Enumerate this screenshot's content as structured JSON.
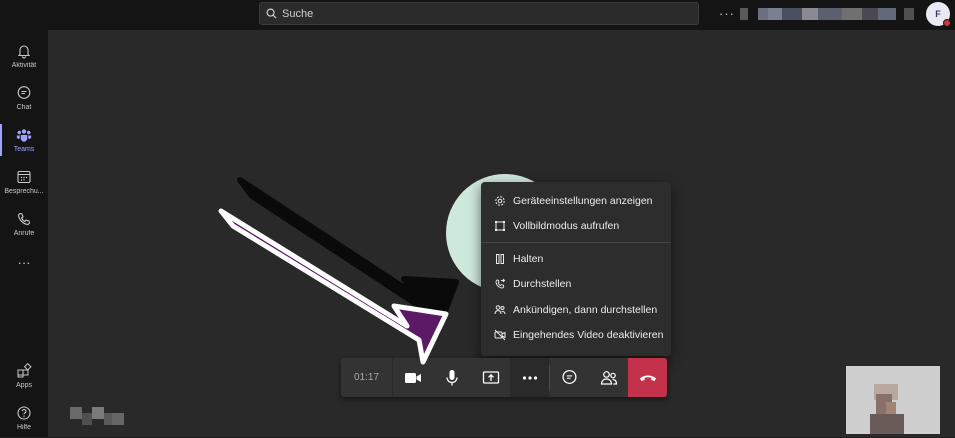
{
  "search": {
    "placeholder": "Suche"
  },
  "topbar": {
    "more": "···",
    "avatar_initial": "F"
  },
  "rail": {
    "items": [
      {
        "label": "Aktivität",
        "icon": "bell-icon"
      },
      {
        "label": "Chat",
        "icon": "chat-icon"
      },
      {
        "label": "Teams",
        "icon": "teams-icon",
        "active": true
      },
      {
        "label": "Besprechu...",
        "icon": "calendar-icon"
      },
      {
        "label": "Anrufe",
        "icon": "phone-icon"
      }
    ],
    "more": "···",
    "apps": "Apps",
    "help": "Hilfe"
  },
  "menu": {
    "items": [
      {
        "label": "Geräteeinstellungen anzeigen",
        "icon": "gear-icon"
      },
      {
        "label": "Vollbildmodus aufrufen",
        "icon": "fullscreen-icon"
      },
      {
        "label": "Halten",
        "icon": "pause-icon"
      },
      {
        "label": "Durchstellen",
        "icon": "transfer-icon"
      },
      {
        "label": "Ankündigen, dann durchstellen",
        "icon": "consult-transfer-icon"
      },
      {
        "label": "Eingehendes Video deaktivieren",
        "icon": "video-off-icon"
      }
    ]
  },
  "controls": {
    "timer": "01:17"
  },
  "colors": {
    "accent": "#9ea2ff",
    "hangup": "#c4314b",
    "arrow": "#5c1a66"
  }
}
